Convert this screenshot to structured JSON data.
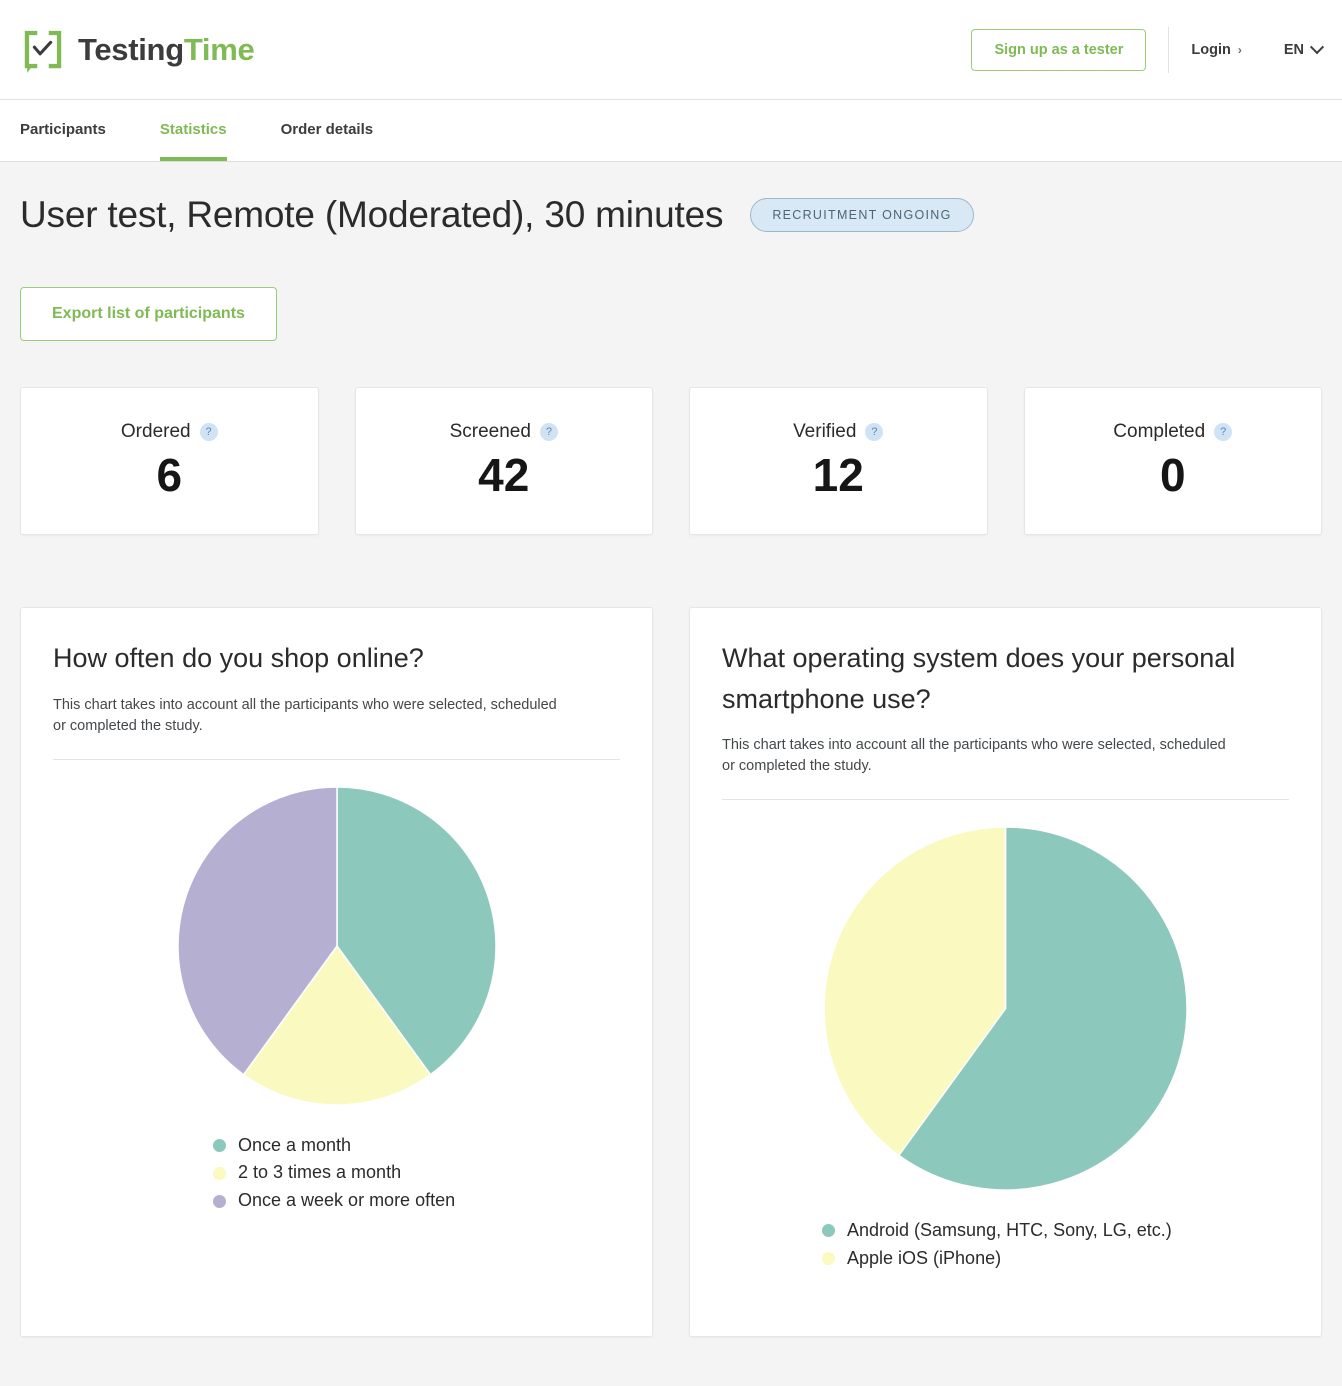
{
  "header": {
    "brand_first": "Testing",
    "brand_second": "Time",
    "signup_label": "Sign up as a tester",
    "login_label": "Login",
    "login_chevron": "›",
    "language_label": "EN"
  },
  "tabs": [
    {
      "label": "Participants",
      "active": false
    },
    {
      "label": "Statistics",
      "active": true
    },
    {
      "label": "Order details",
      "active": false
    }
  ],
  "main": {
    "title": "User test, Remote (Moderated), 30 minutes",
    "status_badge": "RECRUITMENT ONGOING",
    "export_label": "Export list of participants"
  },
  "stats": [
    {
      "label": "Ordered",
      "value": "6",
      "help": "?"
    },
    {
      "label": "Screened",
      "value": "42",
      "help": "?"
    },
    {
      "label": "Verified",
      "value": "12",
      "help": "?"
    },
    {
      "label": "Completed",
      "value": "0",
      "help": "?"
    }
  ],
  "colors": {
    "green": "#8cc8bc",
    "yellow": "#fafac0",
    "purple": "#b5afd1",
    "brand_green": "#7fba54",
    "badge_bg": "#d9e8f5",
    "badge_text": "#4a6679"
  },
  "chart_data": [
    {
      "type": "pie",
      "title": "How often do you shop online?",
      "subtitle": "This chart takes into account all the participants who were selected, scheduled or completed the study.",
      "categories": [
        "Once a month",
        "2 to 3 times a month",
        "Once a week or more often"
      ],
      "values": [
        40,
        20,
        40
      ],
      "unit": "percent",
      "colors": [
        "#8cc8bc",
        "#fafac0",
        "#b5afd1"
      ],
      "legend_position": "bottom",
      "start_angle": 0
    },
    {
      "type": "pie",
      "title": "What operating system does your personal smartphone use?",
      "subtitle": "This chart takes into account all the participants who were selected, scheduled or completed the study.",
      "categories": [
        "Android (Samsung, HTC, Sony, LG, etc.)",
        "Apple iOS (iPhone)"
      ],
      "values": [
        60,
        40
      ],
      "unit": "percent",
      "colors": [
        "#8cc8bc",
        "#fafac0"
      ],
      "legend_position": "bottom",
      "start_angle": 0
    }
  ]
}
